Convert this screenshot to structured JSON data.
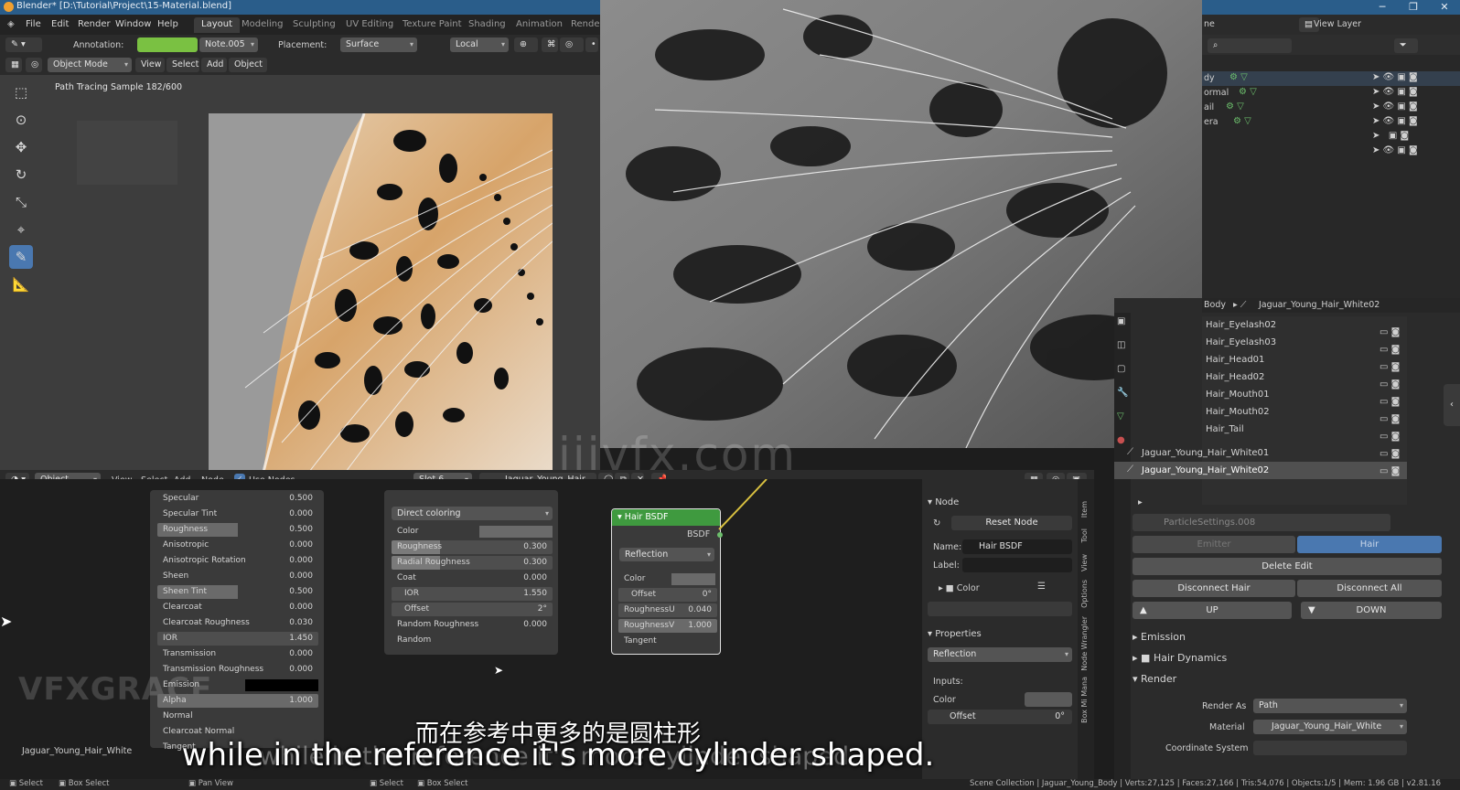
{
  "window": {
    "title": "Blender* [D:\\Tutorial\\Project\\15-Material.blend]"
  },
  "menus": [
    "File",
    "Edit",
    "Render",
    "Window",
    "Help"
  ],
  "workspace_tabs": [
    "Layout",
    "Modeling",
    "Sculpting",
    "UV Editing",
    "Texture Paint",
    "Shading",
    "Animation",
    "Rendering"
  ],
  "tool_header": {
    "annotation_label": "Annotation:",
    "note": "Note.005",
    "placement_label": "Placement:",
    "placement": "Surface",
    "orientation": "Local"
  },
  "viewport_header": {
    "mode": "Object Mode",
    "menus": [
      "View",
      "Select",
      "Add",
      "Object"
    ]
  },
  "viewport": {
    "status": "Path Tracing Sample 182/600"
  },
  "outliner": {
    "scene_label": "ne",
    "view_layer": "View Layer",
    "rows": [
      "dy",
      "ormal",
      "ail",
      "era",
      "",
      ""
    ]
  },
  "properties": {
    "breadcrumb": [
      "Body",
      "Jaguar_Young_Hair_White02"
    ],
    "particle_list": [
      "Hair_Eyelash02",
      "Hair_Eyelash03",
      "Hair_Head01",
      "Hair_Head02",
      "Hair_Mouth01",
      "Hair_Mouth02",
      "Hair_Tail",
      "Jaguar_Young_Hair_White01",
      "Jaguar_Young_Hair_White02"
    ],
    "settings_name": "ParticleSettings.008",
    "type_emitter": "Emitter",
    "type_hair": "Hair",
    "delete_edit": "Delete Edit",
    "disconnect_hair": "Disconnect Hair",
    "disconnect_all": "Disconnect All",
    "up": "UP",
    "down": "DOWN",
    "sections": {
      "emission": "Emission",
      "hair_dynamics": "Hair Dynamics",
      "render": "Render"
    },
    "render_as_label": "Render As",
    "render_as": "Path",
    "material_label": "Material",
    "material": "Jaguar_Young_Hair_White",
    "coord_system_label": "Coordinate System"
  },
  "node_header": {
    "object": "Object",
    "menus": [
      "View",
      "Select",
      "Add",
      "Node"
    ],
    "use_nodes": "Use Nodes",
    "slot": "Slot 6",
    "material": "Jaguar_Young_Hair_..."
  },
  "principled": {
    "rows": [
      {
        "label": "Specular",
        "value": "0.500"
      },
      {
        "label": "Specular Tint",
        "value": "0.000"
      },
      {
        "label": "Roughness",
        "value": "0.500"
      },
      {
        "label": "Anisotropic",
        "value": "0.000"
      },
      {
        "label": "Anisotropic Rotation",
        "value": "0.000"
      },
      {
        "label": "Sheen",
        "value": "0.000"
      },
      {
        "label": "Sheen Tint",
        "value": "0.500"
      },
      {
        "label": "Clearcoat",
        "value": "0.000"
      },
      {
        "label": "Clearcoat Roughness",
        "value": "0.030"
      },
      {
        "label": "IOR",
        "value": "1.450"
      },
      {
        "label": "Transmission",
        "value": "0.000"
      },
      {
        "label": "Transmission Roughness",
        "value": "0.000"
      },
      {
        "label": "Emission",
        "value": ""
      },
      {
        "label": "Alpha",
        "value": "1.000"
      },
      {
        "label": "Normal",
        "value": ""
      },
      {
        "label": "Clearcoat Normal",
        "value": ""
      },
      {
        "label": "Tangent",
        "value": ""
      }
    ],
    "material_label": "Jaguar_Young_Hair_White"
  },
  "principled_hair": {
    "parametrization": "Direct coloring",
    "rows": [
      {
        "label": "Color",
        "value": ""
      },
      {
        "label": "Roughness",
        "value": "0.300"
      },
      {
        "label": "Radial Roughness",
        "value": "0.300"
      },
      {
        "label": "Coat",
        "value": "0.000"
      },
      {
        "label": "IOR",
        "value": "1.550"
      },
      {
        "label": "Offset",
        "value": "2°"
      },
      {
        "label": "Random Roughness",
        "value": "0.000"
      },
      {
        "label": "Random",
        "value": ""
      }
    ]
  },
  "hair_bsdf": {
    "title": "Hair BSDF",
    "output": "BSDF",
    "component": "Reflection",
    "rows": [
      {
        "label": "Color",
        "value": ""
      },
      {
        "label": "Offset",
        "value": "0°"
      },
      {
        "label": "RoughnessU",
        "value": "0.040"
      },
      {
        "label": "RoughnessV",
        "value": "1.000"
      },
      {
        "label": "Tangent",
        "value": ""
      }
    ]
  },
  "npanel": {
    "node_section": "Node",
    "reset": "Reset Node",
    "name_label": "Name:",
    "name": "Hair BSDF",
    "label_label": "Label:",
    "color_label": "Color",
    "properties_section": "Properties",
    "component": "Reflection",
    "inputs_label": "Inputs:",
    "color_input": "Color",
    "offset_label": "Offset",
    "offset": "0°",
    "tabs": [
      "Item",
      "Tool",
      "View",
      "Options",
      "Node Wrangler",
      "Box Mi Mana"
    ]
  },
  "statusbar": {
    "left": [
      "Select",
      "Box Select",
      "Pan View",
      "Select",
      "Box Select"
    ],
    "right": "Scene Collection | Jaguar_Young_Body | Verts:27,125 | Faces:27,166 | Tris:54,076 | Objects:1/5 | Mem: 1.96 GB | v2.81.16"
  },
  "overlay": {
    "subtitle_cn": "而在参考中更多的是圆柱形",
    "subtitle_en": "while in the reference it's more cylinder shaped.",
    "watermark": "iiivfx.com",
    "logo_text": "VFXGRACE"
  },
  "colors": {
    "accent": "#4a78b0",
    "hair_bsdf_header": "#3f9a3f",
    "annotation": "#7ac142"
  }
}
